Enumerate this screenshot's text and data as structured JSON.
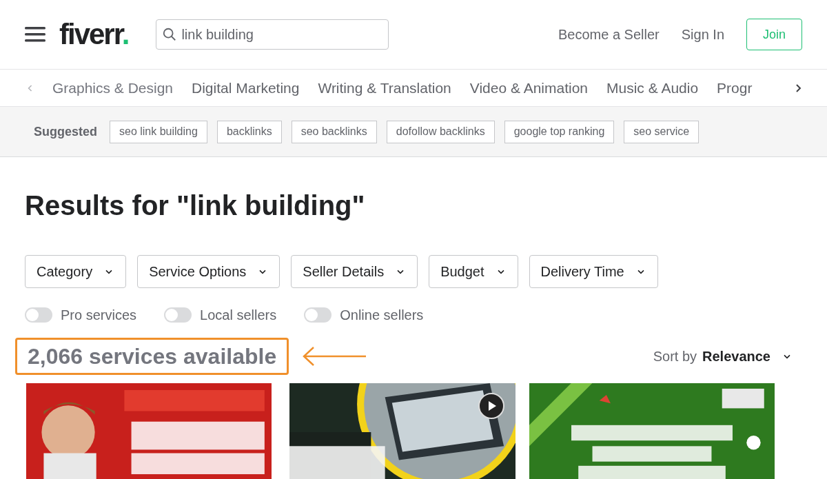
{
  "header": {
    "logo": "fiverr",
    "logo_dot": ".",
    "search": {
      "value": "link building"
    },
    "links": [
      "Become a Seller",
      "Sign In"
    ],
    "join": "Join"
  },
  "categories": {
    "items": [
      "Graphics & Design",
      "Digital Marketing",
      "Writing & Translation",
      "Video & Animation",
      "Music & Audio",
      "Progr"
    ]
  },
  "suggested": {
    "label": "Suggested",
    "tags": [
      "seo link building",
      "backlinks",
      "seo backlinks",
      "dofollow backlinks",
      "google top ranking",
      "seo service"
    ]
  },
  "title": "Results for \"link building\"",
  "filters": [
    "Category",
    "Service Options",
    "Seller Details",
    "Budget",
    "Delivery Time"
  ],
  "toggles": [
    {
      "label": "Pro services",
      "on": false
    },
    {
      "label": "Local sellers",
      "on": false
    },
    {
      "label": "Online sellers",
      "on": false
    }
  ],
  "count": {
    "text": "2,066 services available",
    "highlighted": true
  },
  "sort": {
    "label": "Sort by",
    "value": "Relevance"
  },
  "gigs": [
    {
      "kind": "picture",
      "video": false
    },
    {
      "kind": "picture",
      "video": true
    },
    {
      "kind": "picture",
      "video": false
    }
  ]
}
